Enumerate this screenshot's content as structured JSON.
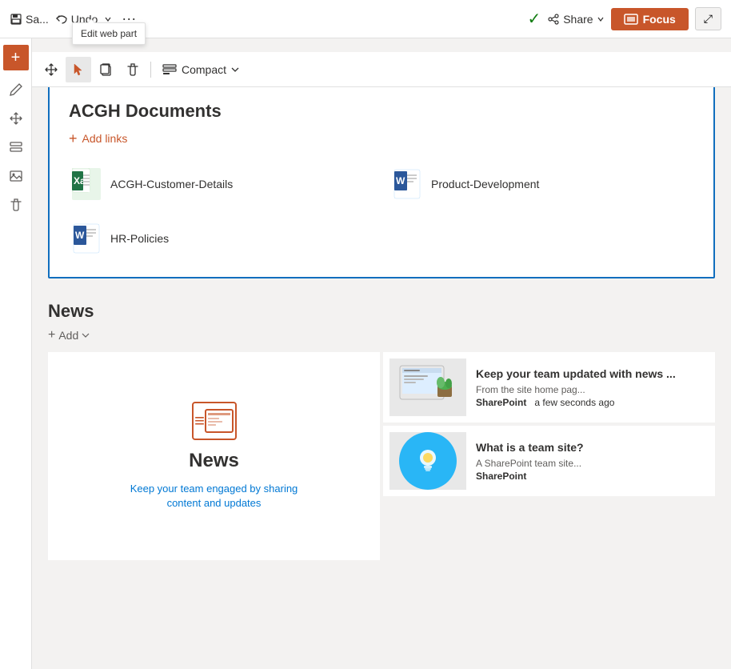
{
  "topbar": {
    "save_label": "Sa...",
    "undo_label": "Undo",
    "checkmark_label": "✓",
    "share_label": "Share",
    "focus_label": "Focus",
    "exit_icon": "⤢"
  },
  "tooltip": {
    "text": "Edit web part"
  },
  "toolbar": {
    "move_icon": "✥",
    "select_icon": "☞",
    "copy_icon": "❐",
    "delete_icon": "🗑",
    "compact_label": "Compact",
    "chevron_icon": "∨"
  },
  "docs_section": {
    "title": "ACGH Documents",
    "add_links_label": "Add links",
    "documents": [
      {
        "name": "ACGH-Customer-Details",
        "type": "excel"
      },
      {
        "name": "Product-Development",
        "type": "word"
      },
      {
        "name": "HR-Policies",
        "type": "word"
      }
    ]
  },
  "news_section": {
    "title": "News",
    "add_label": "Add",
    "promo_card": {
      "icon_label": "news-icon",
      "title": "News",
      "description": "Keep your team engaged by sharing\ncontent and updates"
    },
    "news_items": [
      {
        "title": "Keep your team updated with news ...",
        "source_label": "From the site home pag...",
        "source_name": "SharePoint",
        "time": "a few seconds ago"
      },
      {
        "title": "What is a team site?",
        "source_label": "A SharePoint team site...",
        "source_name": "SharePoint",
        "time": ""
      }
    ]
  }
}
